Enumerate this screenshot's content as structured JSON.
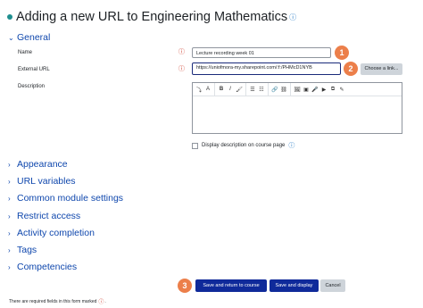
{
  "page": {
    "title": "Adding a new URL to Engineering Mathematics"
  },
  "general": {
    "heading": "General",
    "name_label": "Name",
    "name_value": "Lecture recording week 01",
    "url_label": "External URL",
    "url_value": "https://uniofmora-my.sharepoint.com/:f:/PHMcD1NYB",
    "choose_link": "Choose a link...",
    "description_label": "Description",
    "display_desc_label": "Display description on course page",
    "toolbar": {
      "group1": [
        "⤵",
        "A"
      ],
      "group2": [
        "B",
        "I",
        "🖌"
      ],
      "group3": [
        "☰",
        "☷"
      ],
      "group4": [
        "🔗",
        "⛓"
      ],
      "group5": [
        "🖼",
        "▣",
        "🎤",
        "▶",
        "⧉",
        "✎"
      ]
    }
  },
  "sections": [
    "Appearance",
    "URL variables",
    "Common module settings",
    "Restrict access",
    "Activity completion",
    "Tags",
    "Competencies"
  ],
  "badges": [
    "1",
    "2",
    "3"
  ],
  "actions": {
    "save_return": "Save and return to course",
    "save_display": "Save and display",
    "cancel": "Cancel"
  },
  "footer": {
    "required_note": "There are required fields in this form marked"
  },
  "colors": {
    "link": "#0f47ad",
    "primary": "#0f2a9a",
    "badge": "#ec7f4a",
    "required": "#ca3120"
  }
}
